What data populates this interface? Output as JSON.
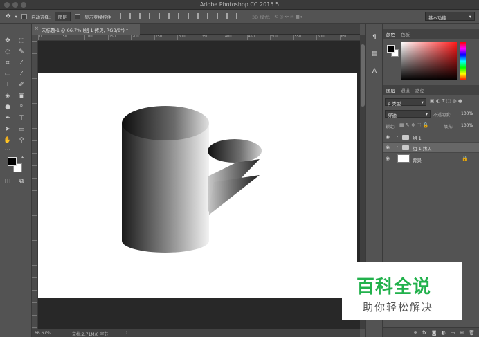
{
  "window": {
    "title": "Adobe Photoshop CC 2015.5"
  },
  "options_bar": {
    "auto_select_label": "自动选择:",
    "auto_select_value": "图层",
    "show_transform_label": "显示变换控件",
    "mode_3d_label": "3D 模式:",
    "workspace": "基本功能"
  },
  "document": {
    "tab_title": "未标题-1 @ 66.7% (组 1 拷贝, RGB/8*) *",
    "ruler_ticks": [
      "0",
      "50",
      "100",
      "150",
      "200",
      "250",
      "300",
      "350",
      "400",
      "450",
      "500",
      "550",
      "600",
      "650",
      "700",
      "750",
      "800",
      "850",
      "900",
      "950"
    ]
  },
  "status": {
    "zoom": "66.67%",
    "doc_info": "文档:2.71M/0 字节",
    "arrow": "›"
  },
  "color_panel": {
    "tabs": [
      "颜色",
      "色板"
    ],
    "fg": "#000000",
    "bg": "#ffffff"
  },
  "layers_panel": {
    "tabs": [
      "图层",
      "通道",
      "路径"
    ],
    "filter_kind": "ρ 类型",
    "blend_mode": "穿透",
    "opacity_label": "不透明度:",
    "opacity_value": "100%",
    "lock_label": "锁定:",
    "fill_label": "填充:",
    "fill_value": "100%",
    "layers": [
      {
        "name": "组 1",
        "type": "group"
      },
      {
        "name": "组 1 拷贝",
        "type": "group",
        "selected": true
      },
      {
        "name": "背景",
        "type": "background",
        "locked": true
      }
    ],
    "bottom_icons": [
      "link-icon",
      "fx-icon",
      "mask-icon",
      "adjustment-icon",
      "folder-icon",
      "new-layer-icon",
      "trash-icon"
    ]
  },
  "watermark": {
    "big": "百科全说",
    "small": "助你轻松解决"
  },
  "colors": {
    "watermark_green": "#22b14c",
    "ui_gray": "#535353",
    "pasteboard": "#282828"
  }
}
